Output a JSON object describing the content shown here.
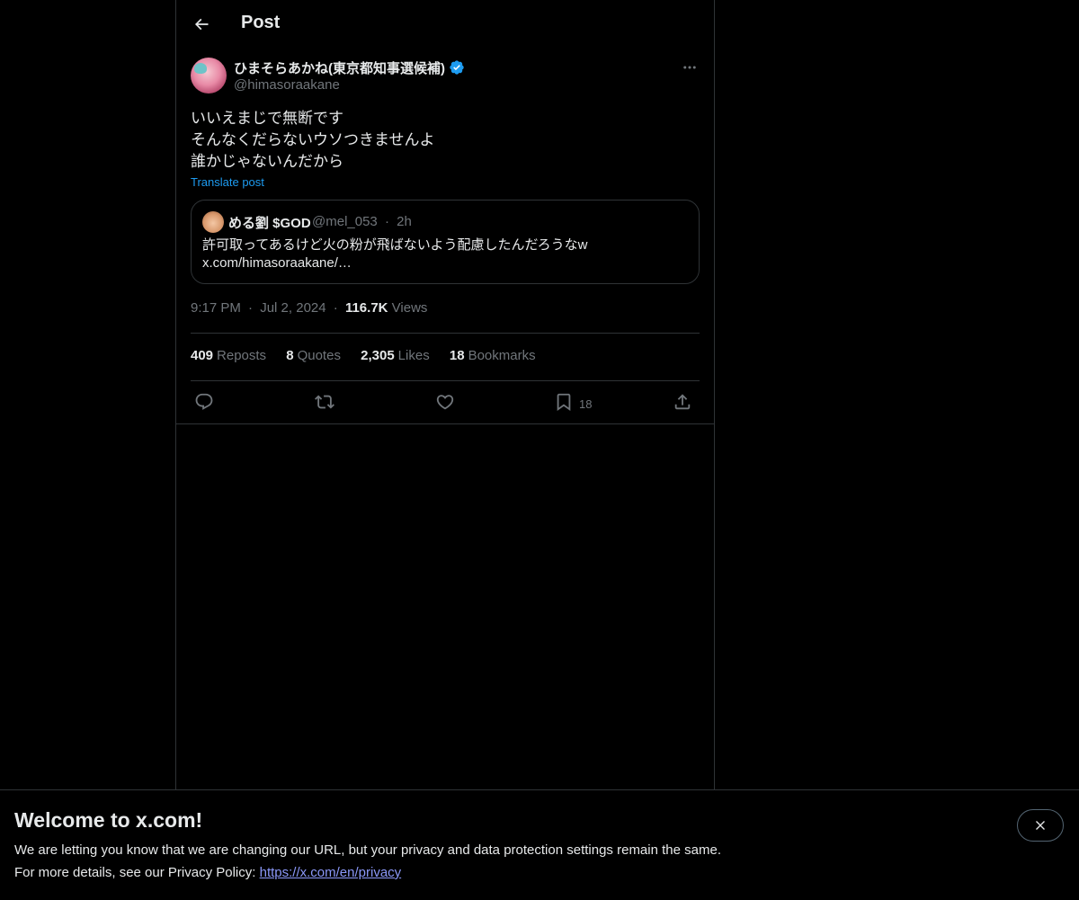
{
  "header": {
    "title": "Post"
  },
  "post": {
    "author_name": "ひまそらあかね(東京都知事選候補)",
    "author_handle": "@himasoraakane",
    "text_lines": [
      "いいえまじで無断です",
      "そんなくだらないウソつきませんよ",
      "誰かじゃないんだから"
    ],
    "translate_label": "Translate post",
    "quote": {
      "name": "める劉 $GOD",
      "handle": "@mel_053",
      "separator": "·",
      "time": "2h",
      "text_line1": "許可取ってあるけど火の粉が飛ばないよう配慮したんだろうなw",
      "text_line2": "x.com/himasoraakane/…"
    },
    "time": "9:17 PM",
    "dot": "·",
    "date": "Jul 2, 2024",
    "views_count": "116.7K",
    "views_label": "Views"
  },
  "stats": [
    {
      "count": "409",
      "label": "Reposts"
    },
    {
      "count": "8",
      "label": "Quotes"
    },
    {
      "count": "2,305",
      "label": "Likes"
    },
    {
      "count": "18",
      "label": "Bookmarks"
    }
  ],
  "actions": {
    "reply_icon": "reply-icon",
    "repost_icon": "repost-icon",
    "like_icon": "like-icon",
    "bookmark_icon": "bookmark-icon",
    "bookmark_count": "18",
    "share_icon": "share-icon"
  },
  "banner": {
    "title": "Welcome to x.com!",
    "line1": "We are letting you know that we are changing our URL, but your privacy and data protection settings remain the same.",
    "line2_prefix": "For more details, see our Privacy Policy:",
    "link": "https://x.com/en/privacy"
  },
  "colors": {
    "background": "#000000",
    "text": "#e7e9ea",
    "secondary": "#71767b",
    "accent": "#1d9bf0",
    "border": "#2f3336",
    "link": "#8b98f9"
  }
}
